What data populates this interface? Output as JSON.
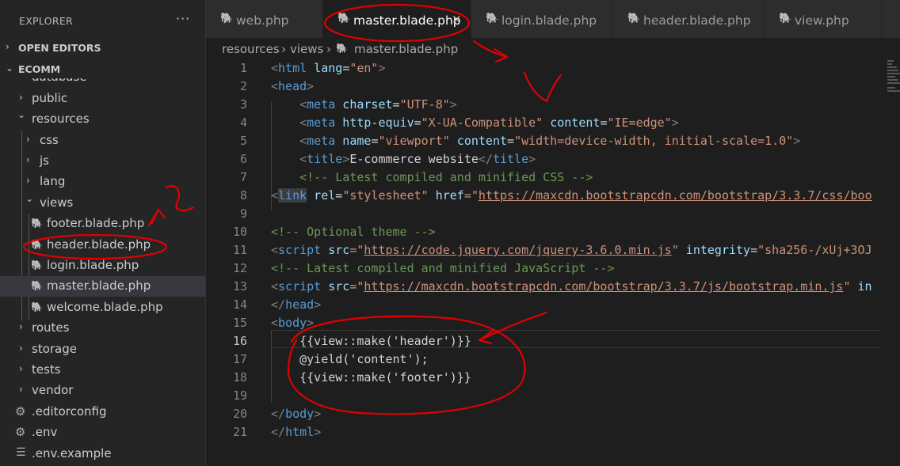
{
  "sidebar": {
    "title": "EXPLORER",
    "more": "···",
    "open_editors": "OPEN EDITORS",
    "project": "ECOMM",
    "cut_item": "database",
    "tree": [
      {
        "label": "public",
        "chev": "›"
      },
      {
        "label": "resources",
        "chev": "⌄"
      },
      {
        "label": "css",
        "chev": "›"
      },
      {
        "label": "js",
        "chev": "›"
      },
      {
        "label": "lang",
        "chev": "›"
      },
      {
        "label": "views",
        "chev": "⌄"
      },
      {
        "label": "footer.blade.php"
      },
      {
        "label": "header.blade.php"
      },
      {
        "label": "login.blade.php"
      },
      {
        "label": "master.blade.php"
      },
      {
        "label": "welcome.blade.php"
      },
      {
        "label": "routes",
        "chev": "›"
      },
      {
        "label": "storage",
        "chev": "›"
      },
      {
        "label": "tests",
        "chev": "›"
      },
      {
        "label": "vendor",
        "chev": "›"
      },
      {
        "label": ".editorconfig"
      },
      {
        "label": ".env"
      },
      {
        "label": ".env.example"
      }
    ]
  },
  "tabs": [
    {
      "label": "web.php"
    },
    {
      "label": "master.blade.php",
      "close": "×"
    },
    {
      "label": "login.blade.php"
    },
    {
      "label": "header.blade.php"
    },
    {
      "label": "view.php"
    }
  ],
  "breadcrumb": {
    "part1": "resources",
    "sep1": "›",
    "part2": "views",
    "sep2": "›",
    "part3": "master.blade.php"
  },
  "editor": {
    "line_numbers": [
      "1",
      "2",
      "3",
      "4",
      "5",
      "6",
      "7",
      "8",
      "9",
      "10",
      "11",
      "12",
      "13",
      "14",
      "15",
      "16",
      "17",
      "18",
      "19",
      "20",
      "21"
    ],
    "current_line": "16",
    "code": {
      "l1": {
        "a": "<",
        "b": "html",
        "c": " lang",
        "d": "=",
        "e": "\"en\"",
        "f": ">"
      },
      "l2": {
        "a": "<",
        "b": "head",
        "c": ">"
      },
      "l3": {
        "indent": "    ",
        "a": "<",
        "b": "meta",
        "c": " charset",
        "d": "=",
        "e": "\"UTF-8\"",
        "f": ">"
      },
      "l4": {
        "indent": "    ",
        "a": "<",
        "b": "meta",
        "c": " http-equiv",
        "d": "=",
        "e": "\"X-UA-Compatible\"",
        "f": " content",
        "g": "=",
        "h": "\"IE=edge\"",
        "i": ">"
      },
      "l5": {
        "indent": "    ",
        "a": "<",
        "b": "meta",
        "c": " name",
        "d": "=",
        "e": "\"viewport\"",
        "f": " content",
        "g": "=",
        "h": "\"width=device-width, initial-scale=1.0\"",
        "i": ">"
      },
      "l6": {
        "indent": "    ",
        "a": "<",
        "b": "title",
        "c": ">",
        "d": "E-commerce website",
        "e": "</",
        "f": "title",
        "g": ">"
      },
      "l7": {
        "indent": "    ",
        "a": "<!-- Latest compiled and minified CSS -->"
      },
      "l8": {
        "a": "<",
        "b": "link",
        "c": " rel",
        "d": "=",
        "e": "\"stylesheet\"",
        "f": " href",
        "g": "=\"",
        "h": "https://maxcdn.bootstrapcdn.com/bootstrap/3.3.7/css/boo"
      },
      "l10": {
        "a": "<!-- Optional theme -->"
      },
      "l11": {
        "a": "<",
        "b": "script",
        "c": " src",
        "d": "=\"",
        "e": "https://code.jquery.com/jquery-3.6.0.min.js",
        "f": "\"",
        "g": " integrity",
        "h": "=",
        "i": "\"sha256-/xUj+3OJ"
      },
      "l12": {
        "a": "<!-- Latest compiled and minified JavaScript -->"
      },
      "l13": {
        "a": "<",
        "b": "script",
        "c": " src",
        "d": "=\"",
        "e": "https://maxcdn.bootstrapcdn.com/bootstrap/3.3.7/js/bootstrap.min.js",
        "f": "\"",
        "g": " in"
      },
      "l14": {
        "a": "</",
        "b": "head",
        "c": ">"
      },
      "l15": {
        "a": "<",
        "b": "body",
        "c": ">"
      },
      "l16": {
        "a": "    {{view::make('header')}}"
      },
      "l17": {
        "a": "    @yield('content');"
      },
      "l18": {
        "a": "    {{view::make('footer')}}"
      },
      "l20": {
        "a": "</",
        "b": "body",
        "c": ">"
      },
      "l21": {
        "a": "</",
        "b": "html",
        "c": ">"
      }
    }
  },
  "colors": {
    "accent_annotation": "#e00000",
    "php_icon": "#b180d7",
    "tag": "#569cd6",
    "string": "#ce9178",
    "attribute": "#9cdcfe",
    "comment": "#6a9955"
  }
}
